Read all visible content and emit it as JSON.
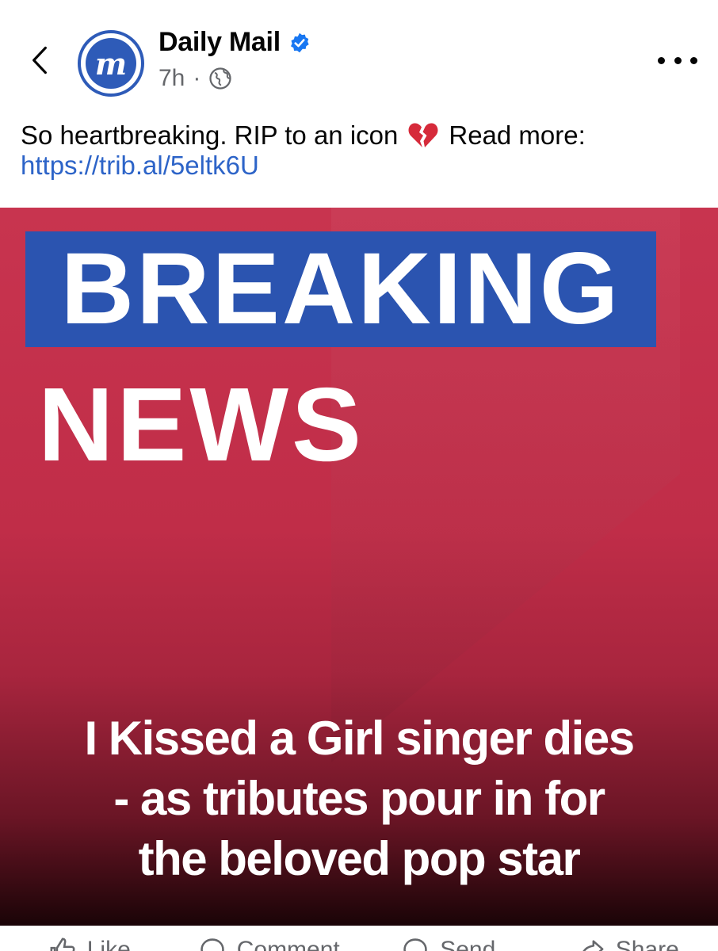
{
  "header": {
    "page_name": "Daily Mail",
    "avatar_letter": "m",
    "time_ago": "7h",
    "separator": "·",
    "icons": {
      "back": "chevron-left-icon",
      "verified": "verified-badge-icon",
      "audience": "globe-icon",
      "more": "more-options-icon"
    },
    "colors": {
      "brand_blue": "#2e5bb8",
      "verified_blue": "#1877f2"
    }
  },
  "post": {
    "caption_text": "So heartbreaking. RIP to an icon",
    "caption_emoji": "broken-heart-icon",
    "caption_after": "Read more:",
    "link": "https://trib.al/5eltk6U"
  },
  "image": {
    "banner_top": "BREAKING",
    "banner_bottom": "NEWS",
    "headline_lines": [
      "I Kissed a Girl singer dies",
      "- as tributes pour in for",
      "the beloved pop star"
    ],
    "colors": {
      "background_red": "#c02d48",
      "banner_blue": "#2b54b0"
    }
  },
  "actions": {
    "like": "Like",
    "comment": "Comment",
    "send": "Send",
    "share": "Share"
  }
}
